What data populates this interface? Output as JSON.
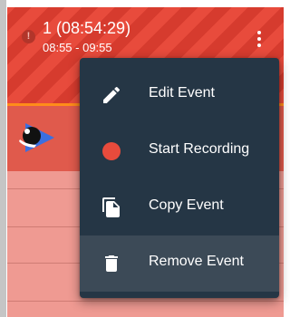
{
  "event": {
    "title": "1 (08:54:29)",
    "time_range": "08:55 - 09:55",
    "status_icon": "alert-circle-icon",
    "more_icon": "more-vertical-icon"
  },
  "context_menu": {
    "items": [
      {
        "label": "Edit Event",
        "icon": "pencil-icon"
      },
      {
        "label": "Start Recording",
        "icon": "record-icon"
      },
      {
        "label": "Copy Event",
        "icon": "copy-icon"
      },
      {
        "label": "Remove Event",
        "icon": "trash-icon"
      }
    ],
    "selected": "Remove Event"
  },
  "colors": {
    "event_red": "#e84b3c",
    "event_stripe": "#d63b2e",
    "current_time_line": "#ff8c1a",
    "menu_background": "#253645",
    "menu_selected": "#3c4a57",
    "record_dot": "#e84b3c"
  }
}
